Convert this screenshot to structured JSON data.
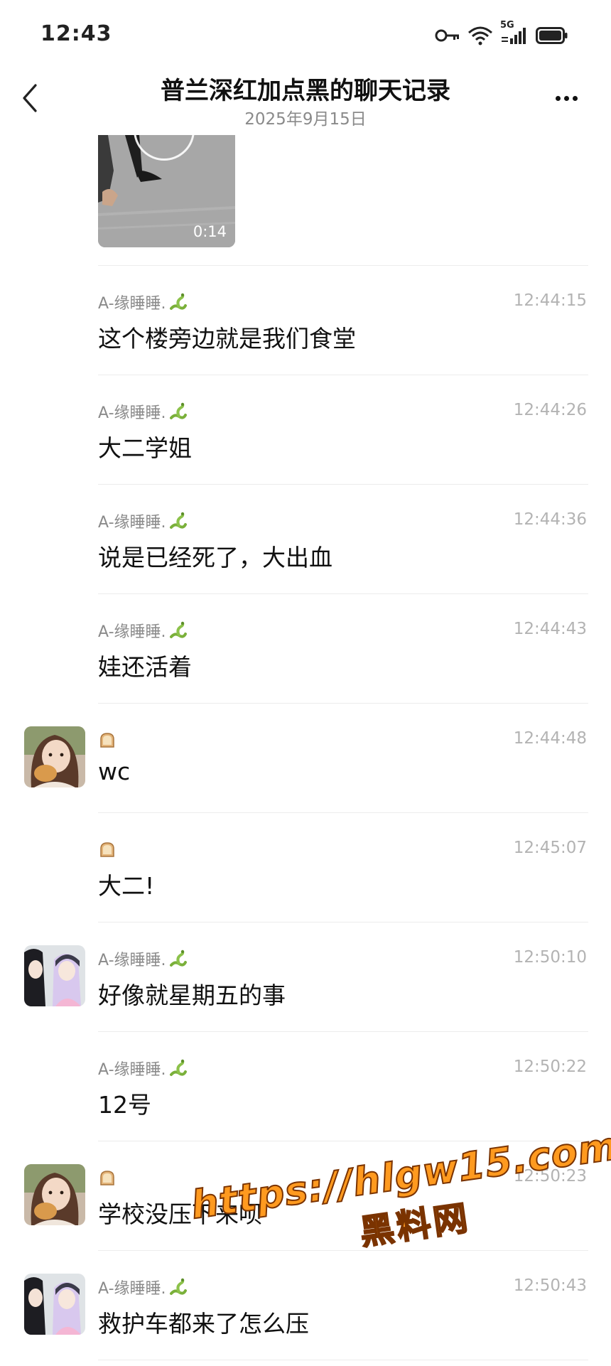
{
  "status_bar": {
    "time": "12:43",
    "network": "5G",
    "icons": [
      "key-icon",
      "wifi-icon",
      "signal-icon",
      "battery-icon"
    ]
  },
  "header": {
    "title": "普兰深红加点黑的聊天记录",
    "subtitle": "2025年9月15日",
    "back_icon": "chevron-left-icon",
    "more_icon": "more-dots-icon"
  },
  "video": {
    "duration": "0:14"
  },
  "messages": [
    {
      "sender": "A-缘睡睡.",
      "sender_emoji": "snake",
      "time": "12:44:15",
      "text": "这个楼旁边就是我们食堂",
      "avatar": ""
    },
    {
      "sender": "A-缘睡睡.",
      "sender_emoji": "snake",
      "time": "12:44:26",
      "text": "大二学姐",
      "avatar": ""
    },
    {
      "sender": "A-缘睡睡.",
      "sender_emoji": "snake",
      "time": "12:44:36",
      "text": "说是已经死了，大出血",
      "avatar": ""
    },
    {
      "sender": "A-缘睡睡.",
      "sender_emoji": "snake",
      "time": "12:44:43",
      "text": "娃还活着",
      "avatar": ""
    },
    {
      "sender": "",
      "sender_emoji": "bread",
      "time": "12:44:48",
      "text": "wc",
      "avatar": "girl"
    },
    {
      "sender": "",
      "sender_emoji": "bread",
      "time": "12:45:07",
      "text": "大二!",
      "avatar": ""
    },
    {
      "sender": "A-缘睡睡.",
      "sender_emoji": "snake",
      "time": "12:50:10",
      "text": "好像就星期五的事",
      "avatar": "anime"
    },
    {
      "sender": "A-缘睡睡.",
      "sender_emoji": "snake",
      "time": "12:50:22",
      "text": "12号",
      "avatar": ""
    },
    {
      "sender": "",
      "sender_emoji": "bread",
      "time": "12:50:23",
      "text": "学校没压下来呗",
      "avatar": "girl"
    },
    {
      "sender": "A-缘睡睡.",
      "sender_emoji": "snake",
      "time": "12:50:43",
      "text": "救护车都来了怎么压",
      "avatar": "anime"
    }
  ],
  "watermark": {
    "line1": "https://hlgw15.com",
    "line2": "黑料网"
  },
  "colors": {
    "background": "#ffffff",
    "time_gray": "#b3b3b3",
    "sender_gray": "#8a8a8a",
    "divider": "#ececec",
    "watermark": "#ff9a1f"
  }
}
